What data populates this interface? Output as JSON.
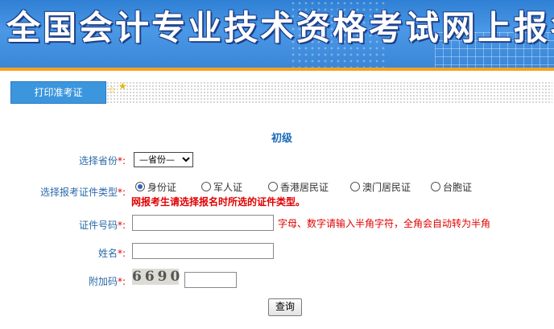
{
  "banner": {
    "title": "全国会计专业技术资格考试网上报名系统"
  },
  "tabs": [
    {
      "label": "打印准考证"
    }
  ],
  "level": "初级",
  "form": {
    "province": {
      "label": "选择省份",
      "required_mark": "*:",
      "selected": "—省份—"
    },
    "id_type": {
      "label": "选择报考证件类型",
      "required_mark": "*:",
      "options": [
        "身份证",
        "军人证",
        "香港居民证",
        "澳门居民证",
        "台胞证"
      ],
      "selected_index": 0,
      "warning": "网报考生请选择报名时所选的证件类型。"
    },
    "id_number": {
      "label": "证件号码",
      "required_mark": "*:",
      "value": "",
      "hint": "字母、数字请输入半角字符，全角会自动转为半角"
    },
    "name": {
      "label": "姓名",
      "required_mark": "*:",
      "value": ""
    },
    "captcha": {
      "label": "附加码",
      "required_mark": "*:",
      "image_text": "6690",
      "value": ""
    },
    "submit_label": "查询"
  },
  "colors": {
    "banner": "#3a8ae0",
    "accent_bar": "#f4a21e",
    "tab": "#3c96de",
    "label": "#2b6aa8",
    "required": "#e00000"
  }
}
